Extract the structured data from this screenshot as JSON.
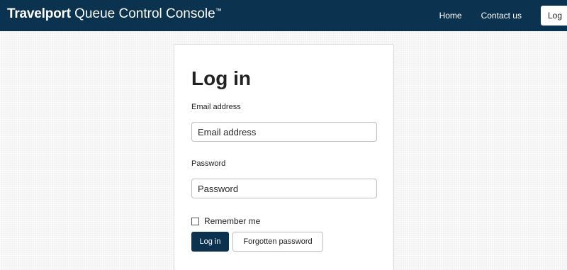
{
  "header": {
    "brand_bold": "Travelport",
    "brand_rest": " Queue Control Console",
    "brand_tm": "™",
    "nav": {
      "home": "Home",
      "contact": "Contact us",
      "login": "Log"
    }
  },
  "login_form": {
    "title": "Log in",
    "email_label": "Email address",
    "email_placeholder": "Email address",
    "password_label": "Password",
    "password_placeholder": "Password",
    "remember_label": "Remember me",
    "remember_checked": false,
    "login_button": "Log in",
    "forgot_button": "Forgotten password"
  },
  "colors": {
    "navbar": "#0b3350",
    "primary_button": "#0b3350",
    "page_background": "#f2f2f2"
  }
}
